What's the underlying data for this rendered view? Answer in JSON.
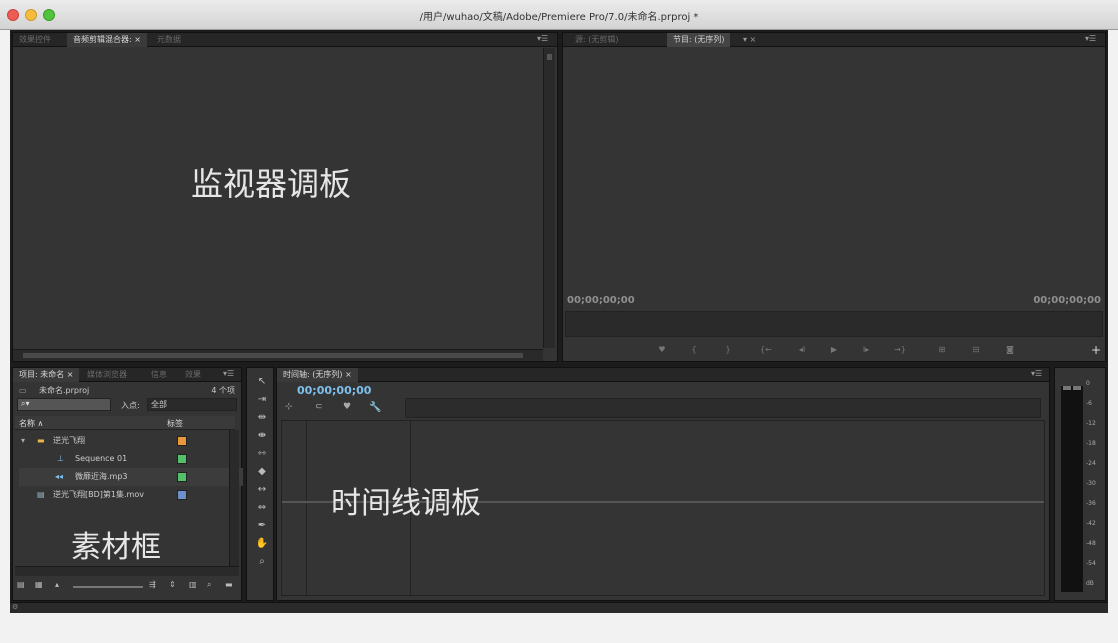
{
  "window": {
    "title": "/用户/wuhao/文稿/Adobe/Premiere Pro/7.0/未命名.prproj *"
  },
  "source_panel": {
    "tabs": [
      "效果控件",
      "音频剪辑混合器: ×",
      "元数据"
    ],
    "overlay_label": "监视器调板"
  },
  "program_panel": {
    "tabs": [
      "源: (无剪辑)",
      "节目: (无序列)",
      "▾ ×"
    ],
    "timecode_left": "00;00;00;00",
    "timecode_right": "00;00;00;00",
    "controls": [
      "mark-in",
      "{",
      "}",
      "go-to-in",
      "step-back",
      "play",
      "step-forward",
      "go-to-out",
      "insert",
      "overwrite",
      "export-frame"
    ],
    "add_button": "+"
  },
  "project_panel": {
    "tabs": [
      "项目: 未命名 ×",
      "媒体浏览器",
      "信息",
      "效果"
    ],
    "project_file": "未命名.prproj",
    "item_count": "4 个项",
    "in_point_label": "入点:",
    "in_point_value": "全部",
    "col_name": "名称 ∧",
    "col_label": "标签",
    "items": [
      {
        "name": "逆光飞翔",
        "icon": "folder-icon",
        "color": "#e8973a",
        "indent": 1
      },
      {
        "name": "Sequence 01",
        "icon": "sequence-icon",
        "color": "#55c06b",
        "indent": 2
      },
      {
        "name": "微靡近海.mp3",
        "icon": "audio-icon",
        "color": "#55c06b",
        "indent": 2
      },
      {
        "name": "逆光飞翔[BD]第1集.mov",
        "icon": "video-icon",
        "color": "#6e8fc8",
        "indent": 1
      }
    ],
    "overlay_label": "素材框"
  },
  "timeline_panel": {
    "tab": "时间轴: (无序列) ×",
    "timecode": "00;00;00;00",
    "overlay_label": "时间线调板"
  },
  "audio_meter": {
    "ticks": [
      "0",
      "-6",
      "-12",
      "-18",
      "-24",
      "-30",
      "-36",
      "-42",
      "-48",
      "-54",
      "dB"
    ]
  },
  "colors": {
    "panel": "#343434",
    "frame": "#1c1c1c",
    "accent": "#7ec0ee"
  }
}
